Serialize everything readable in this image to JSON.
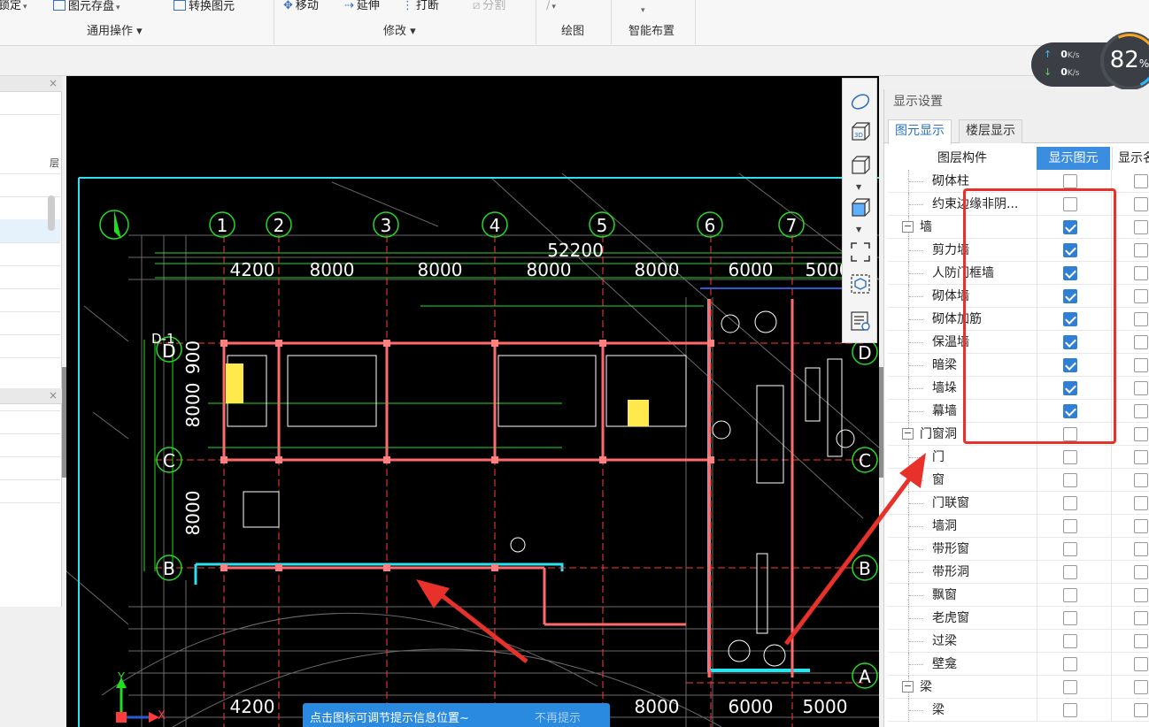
{
  "ribbon": {
    "items": [
      {
        "label": "锁定",
        "caret": "▾",
        "icon": "lock-icon"
      },
      {
        "label": "图元存盘",
        "caret": "▾",
        "icon": "save-element-icon"
      },
      {
        "label": "转换图元",
        "icon": "convert-element-icon"
      },
      {
        "label": "移动",
        "icon": "move-icon"
      },
      {
        "label": "延伸",
        "icon": "extend-icon"
      },
      {
        "label": "打断",
        "icon": "break-icon"
      },
      {
        "label": "分割",
        "icon": "split-icon",
        "disabled": true
      },
      {
        "label": "▾",
        "icon": "draw-tool-icon"
      },
      {
        "label": "▾",
        "icon": "smart-layout-icon"
      }
    ],
    "groups": {
      "general": "通用操作 ▾",
      "modify": "修改 ▾",
      "draw": "绘图",
      "smart_layout": "智能布置"
    }
  },
  "speed_widget": {
    "upload": "0",
    "download": "0",
    "unit": "K/s",
    "percent": "82",
    "percent_unit": "%",
    "upload_arrow": "↑",
    "download_arrow": "↓"
  },
  "left_panel": {
    "close_top": "×",
    "close_mid": "×",
    "cut_text": "层"
  },
  "canvas": {
    "dimensions_top": [
      "4200",
      "8000",
      "8000",
      "8000",
      "8000",
      "6000",
      "5000"
    ],
    "total_dimension": "52200",
    "axis_numbers": [
      "1",
      "2",
      "3",
      "4",
      "5",
      "6",
      "7"
    ],
    "axis_letters_left": [
      "D",
      "C",
      "B"
    ],
    "axis_letters_right": [
      "D",
      "C",
      "B",
      "A"
    ],
    "top_axis_small_label": "D-1",
    "left_dims": [
      "900",
      "8000",
      "8000"
    ],
    "dimensions_bottom": [
      "4200",
      "8000",
      "6000",
      "5000"
    ],
    "axis_y": "Y",
    "axis_x": "X"
  },
  "hint": {
    "message": "点击图标可调节提示信息位置~",
    "no_more": "不再提示"
  },
  "display_settings": {
    "title": "显示设置",
    "tabs": [
      "图元显示",
      "楼层显示"
    ],
    "columns": [
      "图层构件",
      "显示图元",
      "显示名"
    ],
    "rows": [
      {
        "name": "砌体柱",
        "level": 2,
        "show": false,
        "show_name": false
      },
      {
        "name": "约束边缘非阴...",
        "level": 2,
        "show": false,
        "show_name": false
      },
      {
        "name": "墙",
        "level": 1,
        "expander": "−",
        "show": true,
        "show_name": false
      },
      {
        "name": "剪力墙",
        "level": 2,
        "show": true,
        "show_name": false
      },
      {
        "name": "人防门框墙",
        "level": 2,
        "show": true,
        "show_name": false
      },
      {
        "name": "砌体墙",
        "level": 2,
        "show": true,
        "show_name": false
      },
      {
        "name": "砌体加筋",
        "level": 2,
        "show": true,
        "show_name": false
      },
      {
        "name": "保温墙",
        "level": 2,
        "show": true,
        "show_name": false
      },
      {
        "name": "暗梁",
        "level": 2,
        "show": true,
        "show_name": false
      },
      {
        "name": "墙垛",
        "level": 2,
        "show": true,
        "show_name": false
      },
      {
        "name": "幕墙",
        "level": 2,
        "show": true,
        "show_name": false
      },
      {
        "name": "门窗洞",
        "level": 1,
        "expander": "−",
        "show": false,
        "show_name": false
      },
      {
        "name": "门",
        "level": 2,
        "show": false,
        "show_name": false
      },
      {
        "name": "窗",
        "level": 2,
        "show": false,
        "show_name": false
      },
      {
        "name": "门联窗",
        "level": 2,
        "show": false,
        "show_name": false
      },
      {
        "name": "墙洞",
        "level": 2,
        "show": false,
        "show_name": false
      },
      {
        "name": "带形窗",
        "level": 2,
        "show": false,
        "show_name": false
      },
      {
        "name": "带形洞",
        "level": 2,
        "show": false,
        "show_name": false
      },
      {
        "name": "飘窗",
        "level": 2,
        "show": false,
        "show_name": false
      },
      {
        "name": "老虎窗",
        "level": 2,
        "show": false,
        "show_name": false
      },
      {
        "name": "过梁",
        "level": 2,
        "show": false,
        "show_name": false
      },
      {
        "name": "壁龛",
        "level": 2,
        "show": false,
        "show_name": false
      },
      {
        "name": "梁",
        "level": 1,
        "expander": "−",
        "show": false,
        "show_name": false
      },
      {
        "name": "梁",
        "level": 2,
        "show": false,
        "show_name": false
      }
    ]
  },
  "colors": {
    "accent": "#2f7fd6",
    "highlight_box": "#e8312a",
    "canvas_bg": "#000000",
    "cad_green": "#22dd22",
    "cad_cyan": "#29e3f0",
    "cad_red": "#ff3b3b"
  }
}
